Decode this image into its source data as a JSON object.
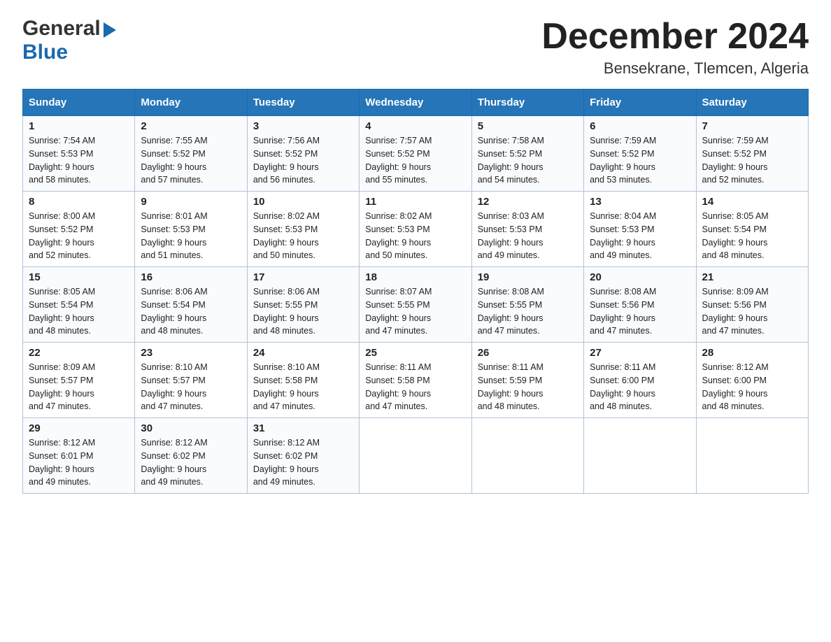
{
  "logo": {
    "general": "General",
    "blue": "Blue",
    "triangle": "▶"
  },
  "title": "December 2024",
  "subtitle": "Bensekrane, Tlemcen, Algeria",
  "header_days": [
    "Sunday",
    "Monday",
    "Tuesday",
    "Wednesday",
    "Thursday",
    "Friday",
    "Saturday"
  ],
  "weeks": [
    [
      {
        "day": "1",
        "sunrise": "7:54 AM",
        "sunset": "5:53 PM",
        "daylight": "9 hours and 58 minutes."
      },
      {
        "day": "2",
        "sunrise": "7:55 AM",
        "sunset": "5:52 PM",
        "daylight": "9 hours and 57 minutes."
      },
      {
        "day": "3",
        "sunrise": "7:56 AM",
        "sunset": "5:52 PM",
        "daylight": "9 hours and 56 minutes."
      },
      {
        "day": "4",
        "sunrise": "7:57 AM",
        "sunset": "5:52 PM",
        "daylight": "9 hours and 55 minutes."
      },
      {
        "day": "5",
        "sunrise": "7:58 AM",
        "sunset": "5:52 PM",
        "daylight": "9 hours and 54 minutes."
      },
      {
        "day": "6",
        "sunrise": "7:59 AM",
        "sunset": "5:52 PM",
        "daylight": "9 hours and 53 minutes."
      },
      {
        "day": "7",
        "sunrise": "7:59 AM",
        "sunset": "5:52 PM",
        "daylight": "9 hours and 52 minutes."
      }
    ],
    [
      {
        "day": "8",
        "sunrise": "8:00 AM",
        "sunset": "5:52 PM",
        "daylight": "9 hours and 52 minutes."
      },
      {
        "day": "9",
        "sunrise": "8:01 AM",
        "sunset": "5:53 PM",
        "daylight": "9 hours and 51 minutes."
      },
      {
        "day": "10",
        "sunrise": "8:02 AM",
        "sunset": "5:53 PM",
        "daylight": "9 hours and 50 minutes."
      },
      {
        "day": "11",
        "sunrise": "8:02 AM",
        "sunset": "5:53 PM",
        "daylight": "9 hours and 50 minutes."
      },
      {
        "day": "12",
        "sunrise": "8:03 AM",
        "sunset": "5:53 PM",
        "daylight": "9 hours and 49 minutes."
      },
      {
        "day": "13",
        "sunrise": "8:04 AM",
        "sunset": "5:53 PM",
        "daylight": "9 hours and 49 minutes."
      },
      {
        "day": "14",
        "sunrise": "8:05 AM",
        "sunset": "5:54 PM",
        "daylight": "9 hours and 48 minutes."
      }
    ],
    [
      {
        "day": "15",
        "sunrise": "8:05 AM",
        "sunset": "5:54 PM",
        "daylight": "9 hours and 48 minutes."
      },
      {
        "day": "16",
        "sunrise": "8:06 AM",
        "sunset": "5:54 PM",
        "daylight": "9 hours and 48 minutes."
      },
      {
        "day": "17",
        "sunrise": "8:06 AM",
        "sunset": "5:55 PM",
        "daylight": "9 hours and 48 minutes."
      },
      {
        "day": "18",
        "sunrise": "8:07 AM",
        "sunset": "5:55 PM",
        "daylight": "9 hours and 47 minutes."
      },
      {
        "day": "19",
        "sunrise": "8:08 AM",
        "sunset": "5:55 PM",
        "daylight": "9 hours and 47 minutes."
      },
      {
        "day": "20",
        "sunrise": "8:08 AM",
        "sunset": "5:56 PM",
        "daylight": "9 hours and 47 minutes."
      },
      {
        "day": "21",
        "sunrise": "8:09 AM",
        "sunset": "5:56 PM",
        "daylight": "9 hours and 47 minutes."
      }
    ],
    [
      {
        "day": "22",
        "sunrise": "8:09 AM",
        "sunset": "5:57 PM",
        "daylight": "9 hours and 47 minutes."
      },
      {
        "day": "23",
        "sunrise": "8:10 AM",
        "sunset": "5:57 PM",
        "daylight": "9 hours and 47 minutes."
      },
      {
        "day": "24",
        "sunrise": "8:10 AM",
        "sunset": "5:58 PM",
        "daylight": "9 hours and 47 minutes."
      },
      {
        "day": "25",
        "sunrise": "8:11 AM",
        "sunset": "5:58 PM",
        "daylight": "9 hours and 47 minutes."
      },
      {
        "day": "26",
        "sunrise": "8:11 AM",
        "sunset": "5:59 PM",
        "daylight": "9 hours and 48 minutes."
      },
      {
        "day": "27",
        "sunrise": "8:11 AM",
        "sunset": "6:00 PM",
        "daylight": "9 hours and 48 minutes."
      },
      {
        "day": "28",
        "sunrise": "8:12 AM",
        "sunset": "6:00 PM",
        "daylight": "9 hours and 48 minutes."
      }
    ],
    [
      {
        "day": "29",
        "sunrise": "8:12 AM",
        "sunset": "6:01 PM",
        "daylight": "9 hours and 49 minutes."
      },
      {
        "day": "30",
        "sunrise": "8:12 AM",
        "sunset": "6:02 PM",
        "daylight": "9 hours and 49 minutes."
      },
      {
        "day": "31",
        "sunrise": "8:12 AM",
        "sunset": "6:02 PM",
        "daylight": "9 hours and 49 minutes."
      },
      null,
      null,
      null,
      null
    ]
  ],
  "labels": {
    "sunrise": "Sunrise:",
    "sunset": "Sunset:",
    "daylight": "Daylight:"
  }
}
